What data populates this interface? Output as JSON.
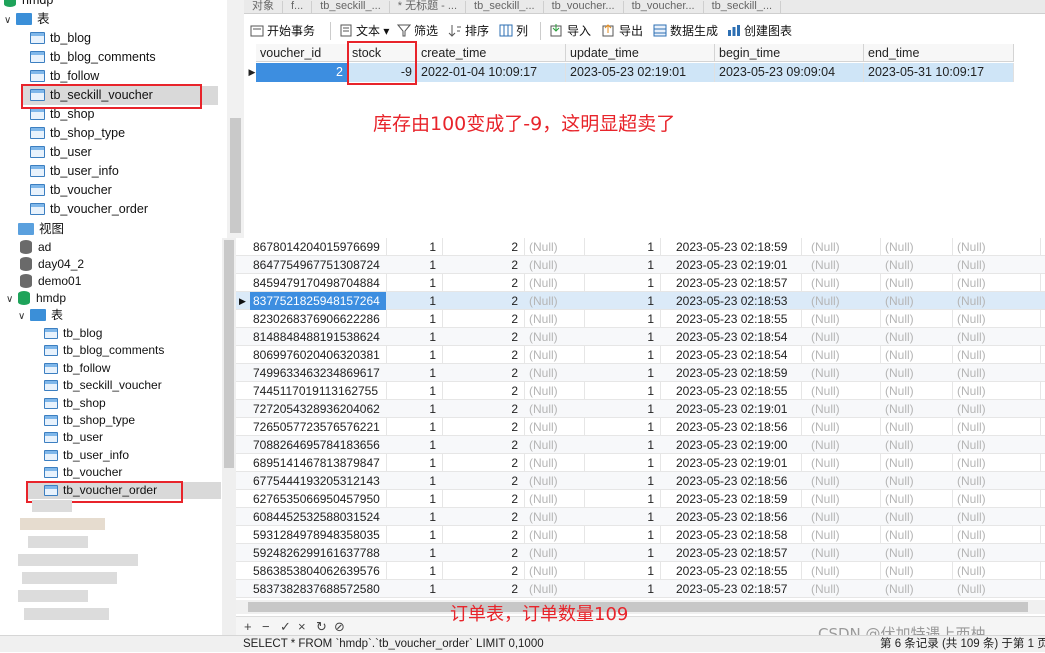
{
  "top": {
    "sidebar": {
      "db_name": "hmdp",
      "tables_folder": "表",
      "tables": [
        "tb_blog",
        "tb_blog_comments",
        "tb_follow",
        "tb_seckill_voucher",
        "tb_shop",
        "tb_shop_type",
        "tb_user",
        "tb_user_info",
        "tb_voucher",
        "tb_voucher_order"
      ],
      "views_folder": "视图"
    },
    "tabs": [
      "对象",
      "f...",
      "tb_seckill_...",
      "* 无标题 - ...",
      "tb_seckill_...",
      "tb_voucher...",
      "tb_voucher...",
      "tb_seckill_..."
    ],
    "toolbar": {
      "begin_tx": "开始事务",
      "text": "文本",
      "filter": "筛选",
      "sort": "排序",
      "columns": "列",
      "import": "导入",
      "export": "导出",
      "data_gen": "数据生成",
      "create_chart": "创建图表"
    },
    "grid": {
      "headers": [
        "voucher_id",
        "stock",
        "create_time",
        "update_time",
        "begin_time",
        "end_time"
      ],
      "row": [
        "2",
        "-9",
        "2022-01-04 10:09:17",
        "2023-05-23 02:19:01",
        "2023-05-23 09:09:04",
        "2023-05-31 10:09:17"
      ]
    },
    "annotation": "库存由100变成了-9，这明显超卖了"
  },
  "bottom": {
    "sidebar": {
      "dbs": [
        "ad",
        "day04_2",
        "demo01",
        "hmdp"
      ],
      "tables_folder": "表",
      "tables": [
        "tb_blog",
        "tb_blog_comments",
        "tb_follow",
        "tb_seckill_voucher",
        "tb_shop",
        "tb_shop_type",
        "tb_user",
        "tb_user_info",
        "tb_voucher",
        "tb_voucher_order"
      ]
    },
    "null_text": "(Null)",
    "rows": [
      {
        "id": "8678014204015976699",
        "user": "1",
        "voucher": "2",
        "time": "2023-05-23 02:18:59"
      },
      {
        "id": "8647754967751308724",
        "user": "1",
        "voucher": "2",
        "time": "2023-05-23 02:19:01"
      },
      {
        "id": "8459479170498704884",
        "user": "1",
        "voucher": "2",
        "time": "2023-05-23 02:18:57"
      },
      {
        "id": "8377521825948157264",
        "user": "1",
        "voucher": "2",
        "time": "2023-05-23 02:18:53"
      },
      {
        "id": "8230268376906622286",
        "user": "1",
        "voucher": "2",
        "time": "2023-05-23 02:18:55"
      },
      {
        "id": "8148848488191538624",
        "user": "1",
        "voucher": "2",
        "time": "2023-05-23 02:18:54"
      },
      {
        "id": "8069976020406320381",
        "user": "1",
        "voucher": "2",
        "time": "2023-05-23 02:18:54"
      },
      {
        "id": "7499633463234869617",
        "user": "1",
        "voucher": "2",
        "time": "2023-05-23 02:18:59"
      },
      {
        "id": "7445117019113162755",
        "user": "1",
        "voucher": "2",
        "time": "2023-05-23 02:18:55"
      },
      {
        "id": "7272054328936204062",
        "user": "1",
        "voucher": "2",
        "time": "2023-05-23 02:19:01"
      },
      {
        "id": "7265057723576576221",
        "user": "1",
        "voucher": "2",
        "time": "2023-05-23 02:18:56"
      },
      {
        "id": "7088264695784183656",
        "user": "1",
        "voucher": "2",
        "time": "2023-05-23 02:19:00"
      },
      {
        "id": "6895141467813879847",
        "user": "1",
        "voucher": "2",
        "time": "2023-05-23 02:19:01"
      },
      {
        "id": "6775444193205312143",
        "user": "1",
        "voucher": "2",
        "time": "2023-05-23 02:18:56"
      },
      {
        "id": "6276535066950457950",
        "user": "1",
        "voucher": "2",
        "time": "2023-05-23 02:18:59"
      },
      {
        "id": "6084452532588031524",
        "user": "1",
        "voucher": "2",
        "time": "2023-05-23 02:18:56"
      },
      {
        "id": "5931284978948358035",
        "user": "1",
        "voucher": "2",
        "time": "2023-05-23 02:18:58"
      },
      {
        "id": "5924826299161637788",
        "user": "1",
        "voucher": "2",
        "time": "2023-05-23 02:18:57"
      },
      {
        "id": "5863853804062639576",
        "user": "1",
        "voucher": "2",
        "time": "2023-05-23 02:18:55"
      },
      {
        "id": "5837382837688572580",
        "user": "1",
        "voucher": "2",
        "time": "2023-05-23 02:18:57"
      }
    ],
    "status_tail": "1",
    "annotation": "订单表，订单数量109",
    "nav_buttons": [
      "+",
      "−",
      "✓",
      "×",
      "↻",
      "⊘"
    ],
    "status": {
      "sql": "SELECT * FROM `hmdp`.`tb_voucher_order` LIMIT 0,1000",
      "record": "第 6 条记录 (共 109 条) 于第 1 页"
    },
    "watermark": "CSDN @伏加特遇上西柚"
  },
  "colors": {
    "accent_red": "#e8242b",
    "selection": "#3d8ee0"
  }
}
